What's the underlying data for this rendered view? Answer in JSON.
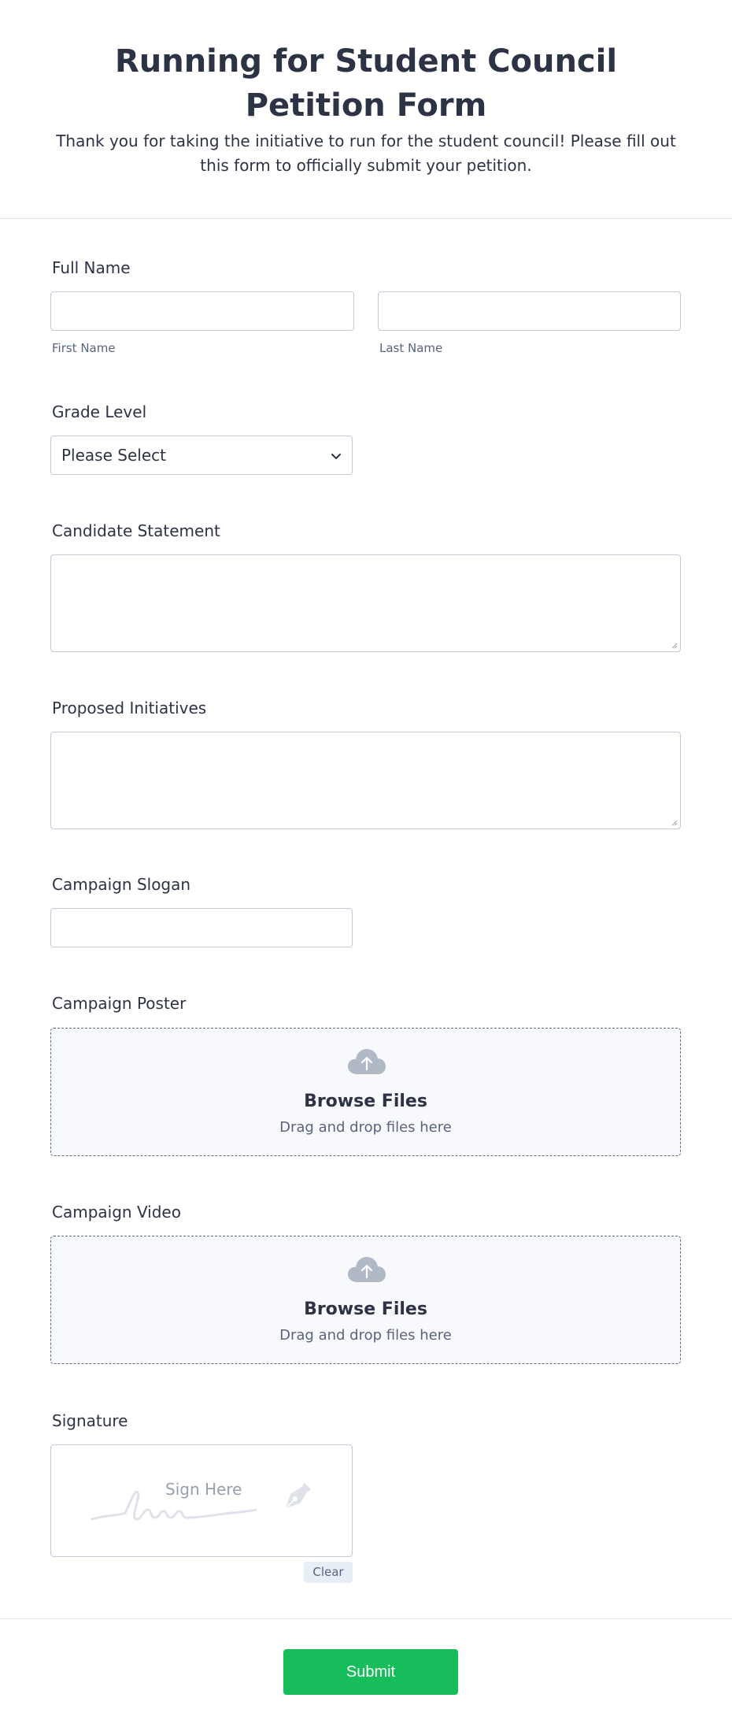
{
  "form": {
    "title": "Running for Student Council Petition Form",
    "subtitle": "Thank you for taking the initiative to run for the student council! Please fill out this form to officially submit your petition."
  },
  "full_name": {
    "label": "Full Name",
    "first_sublabel": "First Name",
    "last_sublabel": "Last Name",
    "first_value": "",
    "last_value": ""
  },
  "grade_level": {
    "label": "Grade Level",
    "selected": "Please Select"
  },
  "candidate_statement": {
    "label": "Candidate Statement",
    "value": ""
  },
  "proposed_initiatives": {
    "label": "Proposed Initiatives",
    "value": ""
  },
  "campaign_slogan": {
    "label": "Campaign Slogan",
    "value": ""
  },
  "campaign_poster": {
    "label": "Campaign Poster",
    "browse_label": "Browse Files",
    "drag_label": "Drag and drop files here",
    "icon": "cloud-upload-icon"
  },
  "campaign_video": {
    "label": "Campaign Video",
    "browse_label": "Browse Files",
    "drag_label": "Drag and drop files here",
    "icon": "cloud-upload-icon"
  },
  "signature": {
    "label": "Signature",
    "placeholder": "Sign Here",
    "clear_label": "Clear",
    "icon": "pen-nib-icon"
  },
  "submit_label": "Submit",
  "colors": {
    "text": "#2c3345",
    "muted": "#57647e",
    "border": "#c3cad8",
    "submit": "#18bd5b",
    "upload_bg": "#f8f9fd"
  }
}
